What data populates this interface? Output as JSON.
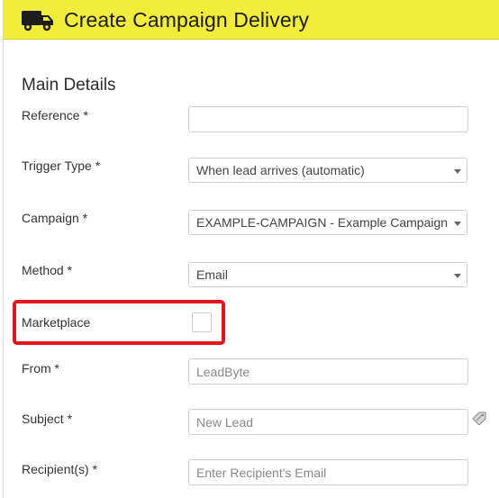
{
  "header": {
    "title": "Create Campaign Delivery",
    "icon": "truck-icon",
    "background": "#f2ec3b"
  },
  "section": {
    "title": "Main Details"
  },
  "form": {
    "reference": {
      "label": "Reference *",
      "value": ""
    },
    "trigger_type": {
      "label": "Trigger Type *",
      "value": "When lead arrives (automatic)"
    },
    "campaign": {
      "label": "Campaign *",
      "value": "EXAMPLE-CAMPAIGN - Example Campaign"
    },
    "method": {
      "label": "Method *",
      "value": "Email"
    },
    "marketplace": {
      "label": "Marketplace",
      "checked": false
    },
    "from": {
      "label": "From *",
      "placeholder": "LeadByte"
    },
    "subject": {
      "label": "Subject *",
      "placeholder": "New Lead",
      "side_icon": "tag-icon"
    },
    "recipients": {
      "label": "Recipient(s) *",
      "placeholder": "Enter Recipient's Email"
    }
  },
  "highlight": {
    "color": "#e8141c"
  }
}
